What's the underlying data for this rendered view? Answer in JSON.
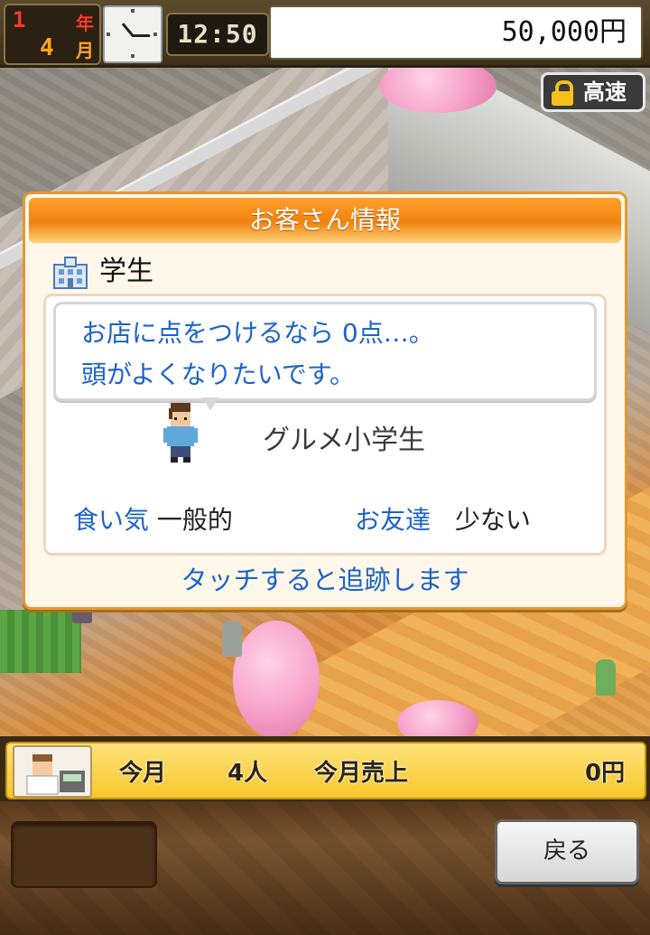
{
  "status_bar": {
    "year_value": "1",
    "year_unit": "年",
    "month_value": "4",
    "month_unit": "月",
    "time": "12:50",
    "money": "50,000円"
  },
  "world": {
    "speed_button_label": "高速"
  },
  "customer_dialog": {
    "title": "お客さん情報",
    "category": "学生",
    "speech_lines": [
      "お店に点をつけるなら 0点…。",
      "頭がよくなりたいです。"
    ],
    "customer_name": "グルメ小学生",
    "appetite_label": "食い気",
    "appetite_value": "一般的",
    "friends_label": "お友達",
    "friends_value": "少ない",
    "hint": "タッチすると追跡します"
  },
  "monthly_bar": {
    "month_label": "今月",
    "visitors": "4人",
    "sales_label": "今月売上",
    "sales_value": "0円"
  },
  "controls": {
    "back_label": "戻る"
  },
  "colors": {
    "accent_orange": "#f08210",
    "text_blue": "#1b64c9",
    "info_yellow": "#f7c72c"
  }
}
